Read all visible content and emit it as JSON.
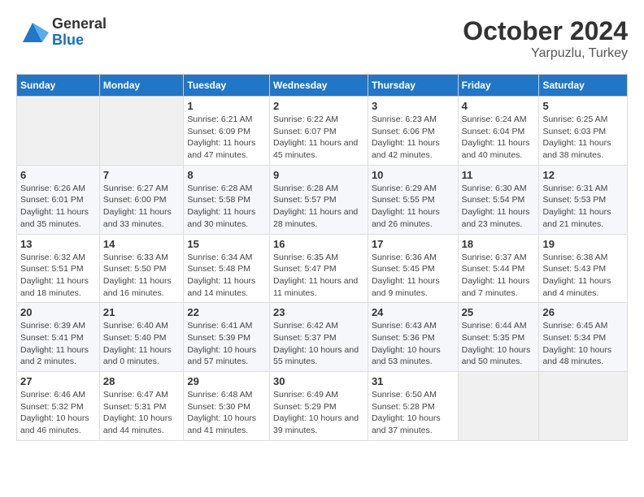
{
  "header": {
    "logo": {
      "general": "General",
      "blue": "Blue"
    },
    "title": "October 2024",
    "subtitle": "Yarpuzlu, Turkey"
  },
  "days_of_week": [
    "Sunday",
    "Monday",
    "Tuesday",
    "Wednesday",
    "Thursday",
    "Friday",
    "Saturday"
  ],
  "weeks": [
    [
      {
        "day": "",
        "content": ""
      },
      {
        "day": "",
        "content": ""
      },
      {
        "day": "1",
        "content": "Sunrise: 6:21 AM\nSunset: 6:09 PM\nDaylight: 11 hours and 47 minutes."
      },
      {
        "day": "2",
        "content": "Sunrise: 6:22 AM\nSunset: 6:07 PM\nDaylight: 11 hours and 45 minutes."
      },
      {
        "day": "3",
        "content": "Sunrise: 6:23 AM\nSunset: 6:06 PM\nDaylight: 11 hours and 42 minutes."
      },
      {
        "day": "4",
        "content": "Sunrise: 6:24 AM\nSunset: 6:04 PM\nDaylight: 11 hours and 40 minutes."
      },
      {
        "day": "5",
        "content": "Sunrise: 6:25 AM\nSunset: 6:03 PM\nDaylight: 11 hours and 38 minutes."
      }
    ],
    [
      {
        "day": "6",
        "content": "Sunrise: 6:26 AM\nSunset: 6:01 PM\nDaylight: 11 hours and 35 minutes."
      },
      {
        "day": "7",
        "content": "Sunrise: 6:27 AM\nSunset: 6:00 PM\nDaylight: 11 hours and 33 minutes."
      },
      {
        "day": "8",
        "content": "Sunrise: 6:28 AM\nSunset: 5:58 PM\nDaylight: 11 hours and 30 minutes."
      },
      {
        "day": "9",
        "content": "Sunrise: 6:28 AM\nSunset: 5:57 PM\nDaylight: 11 hours and 28 minutes."
      },
      {
        "day": "10",
        "content": "Sunrise: 6:29 AM\nSunset: 5:55 PM\nDaylight: 11 hours and 26 minutes."
      },
      {
        "day": "11",
        "content": "Sunrise: 6:30 AM\nSunset: 5:54 PM\nDaylight: 11 hours and 23 minutes."
      },
      {
        "day": "12",
        "content": "Sunrise: 6:31 AM\nSunset: 5:53 PM\nDaylight: 11 hours and 21 minutes."
      }
    ],
    [
      {
        "day": "13",
        "content": "Sunrise: 6:32 AM\nSunset: 5:51 PM\nDaylight: 11 hours and 18 minutes."
      },
      {
        "day": "14",
        "content": "Sunrise: 6:33 AM\nSunset: 5:50 PM\nDaylight: 11 hours and 16 minutes."
      },
      {
        "day": "15",
        "content": "Sunrise: 6:34 AM\nSunset: 5:48 PM\nDaylight: 11 hours and 14 minutes."
      },
      {
        "day": "16",
        "content": "Sunrise: 6:35 AM\nSunset: 5:47 PM\nDaylight: 11 hours and 11 minutes."
      },
      {
        "day": "17",
        "content": "Sunrise: 6:36 AM\nSunset: 5:45 PM\nDaylight: 11 hours and 9 minutes."
      },
      {
        "day": "18",
        "content": "Sunrise: 6:37 AM\nSunset: 5:44 PM\nDaylight: 11 hours and 7 minutes."
      },
      {
        "day": "19",
        "content": "Sunrise: 6:38 AM\nSunset: 5:43 PM\nDaylight: 11 hours and 4 minutes."
      }
    ],
    [
      {
        "day": "20",
        "content": "Sunrise: 6:39 AM\nSunset: 5:41 PM\nDaylight: 11 hours and 2 minutes."
      },
      {
        "day": "21",
        "content": "Sunrise: 6:40 AM\nSunset: 5:40 PM\nDaylight: 11 hours and 0 minutes."
      },
      {
        "day": "22",
        "content": "Sunrise: 6:41 AM\nSunset: 5:39 PM\nDaylight: 10 hours and 57 minutes."
      },
      {
        "day": "23",
        "content": "Sunrise: 6:42 AM\nSunset: 5:37 PM\nDaylight: 10 hours and 55 minutes."
      },
      {
        "day": "24",
        "content": "Sunrise: 6:43 AM\nSunset: 5:36 PM\nDaylight: 10 hours and 53 minutes."
      },
      {
        "day": "25",
        "content": "Sunrise: 6:44 AM\nSunset: 5:35 PM\nDaylight: 10 hours and 50 minutes."
      },
      {
        "day": "26",
        "content": "Sunrise: 6:45 AM\nSunset: 5:34 PM\nDaylight: 10 hours and 48 minutes."
      }
    ],
    [
      {
        "day": "27",
        "content": "Sunrise: 6:46 AM\nSunset: 5:32 PM\nDaylight: 10 hours and 46 minutes."
      },
      {
        "day": "28",
        "content": "Sunrise: 6:47 AM\nSunset: 5:31 PM\nDaylight: 10 hours and 44 minutes."
      },
      {
        "day": "29",
        "content": "Sunrise: 6:48 AM\nSunset: 5:30 PM\nDaylight: 10 hours and 41 minutes."
      },
      {
        "day": "30",
        "content": "Sunrise: 6:49 AM\nSunset: 5:29 PM\nDaylight: 10 hours and 39 minutes."
      },
      {
        "day": "31",
        "content": "Sunrise: 6:50 AM\nSunset: 5:28 PM\nDaylight: 10 hours and 37 minutes."
      },
      {
        "day": "",
        "content": ""
      },
      {
        "day": "",
        "content": ""
      }
    ]
  ]
}
